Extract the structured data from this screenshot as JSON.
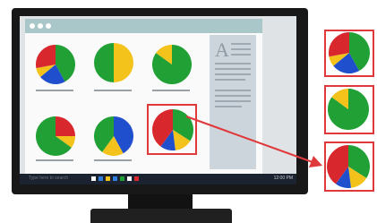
{
  "window": {
    "doc_letter": "A"
  },
  "taskbar": {
    "search_text": "Type here to search",
    "clock": "12:00 PM"
  },
  "grid_pies": [
    {
      "name": "pie-1",
      "slices": [
        {
          "color": "#21a035",
          "fraction": 0.42
        },
        {
          "color": "#1f4fcc",
          "fraction": 0.22
        },
        {
          "color": "#f3c21b",
          "fraction": 0.08
        },
        {
          "color": "#d9272e",
          "fraction": 0.28
        }
      ]
    },
    {
      "name": "pie-2",
      "slices": [
        {
          "color": "#f3c21b",
          "fraction": 0.5
        },
        {
          "color": "#21a035",
          "fraction": 0.5
        }
      ]
    },
    {
      "name": "pie-3",
      "slices": [
        {
          "color": "#21a035",
          "fraction": 0.85
        },
        {
          "color": "#f3c21b",
          "fraction": 0.15
        }
      ]
    },
    {
      "name": "pie-4",
      "slices": [
        {
          "color": "#d9272e",
          "fraction": 0.25
        },
        {
          "color": "#f3c21b",
          "fraction": 0.1
        },
        {
          "color": "#21a035",
          "fraction": 0.65
        }
      ]
    },
    {
      "name": "pie-5",
      "slices": [
        {
          "color": "#1f4fcc",
          "fraction": 0.42
        },
        {
          "color": "#f3c21b",
          "fraction": 0.18
        },
        {
          "color": "#21a035",
          "fraction": 0.4
        }
      ]
    },
    {
      "name": "pie-6",
      "slices": [
        {
          "color": "#21a035",
          "fraction": 0.34
        },
        {
          "color": "#f3c21b",
          "fraction": 0.14
        },
        {
          "color": "#1f4fcc",
          "fraction": 0.12
        },
        {
          "color": "#d9272e",
          "fraction": 0.4
        }
      ]
    }
  ],
  "side_pies": [
    {
      "name": "side-pie-1",
      "slices": [
        {
          "color": "#21a035",
          "fraction": 0.42
        },
        {
          "color": "#1f4fcc",
          "fraction": 0.22
        },
        {
          "color": "#f3c21b",
          "fraction": 0.08
        },
        {
          "color": "#d9272e",
          "fraction": 0.28
        }
      ]
    },
    {
      "name": "side-pie-2",
      "slices": [
        {
          "color": "#21a035",
          "fraction": 0.85
        },
        {
          "color": "#f3c21b",
          "fraction": 0.15
        }
      ]
    },
    {
      "name": "side-pie-3",
      "slices": [
        {
          "color": "#21a035",
          "fraction": 0.34
        },
        {
          "color": "#f3c21b",
          "fraction": 0.14
        },
        {
          "color": "#1f4fcc",
          "fraction": 0.12
        },
        {
          "color": "#d9272e",
          "fraction": 0.4
        }
      ]
    }
  ],
  "colors": {
    "highlight": "#e0393b",
    "titlebar": "#a9c7c9"
  }
}
